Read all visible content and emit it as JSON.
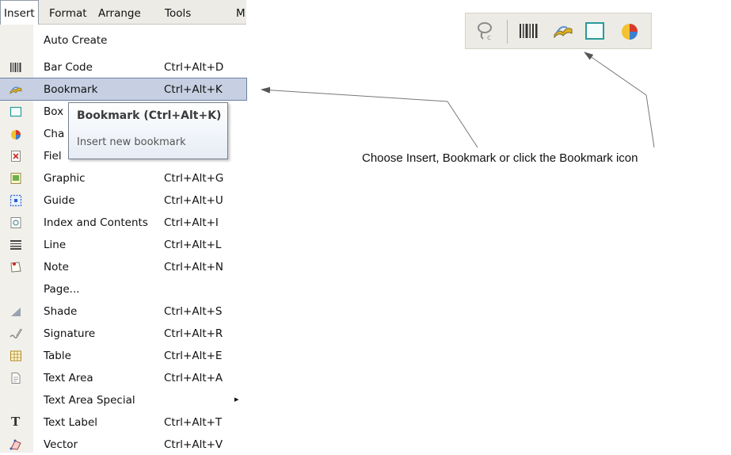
{
  "menubar": {
    "items": [
      "Insert",
      "Format",
      "Arrange",
      "Tools",
      "M"
    ]
  },
  "menu": {
    "items": [
      {
        "label": "Auto Create",
        "shortcut": "",
        "icon": "none"
      },
      {
        "label": "Bar Code",
        "shortcut": "Ctrl+Alt+D",
        "icon": "barcode-icon"
      },
      {
        "label": "Bookmark",
        "shortcut": "Ctrl+Alt+K",
        "icon": "bookmark-icon",
        "highlighted": true
      },
      {
        "label": "Box",
        "shortcut": "",
        "icon": "box-icon"
      },
      {
        "label": "Cha",
        "shortcut": "",
        "icon": "chart-icon"
      },
      {
        "label": "Fiel",
        "shortcut": "",
        "icon": "field-icon"
      },
      {
        "label": "Graphic",
        "shortcut": "Ctrl+Alt+G",
        "icon": "graphic-icon"
      },
      {
        "label": "Guide",
        "shortcut": "Ctrl+Alt+U",
        "icon": "guide-icon"
      },
      {
        "label": "Index and Contents",
        "shortcut": "Ctrl+Alt+I",
        "icon": "index-icon"
      },
      {
        "label": "Line",
        "shortcut": "Ctrl+Alt+L",
        "icon": "line-icon"
      },
      {
        "label": "Note",
        "shortcut": "Ctrl+Alt+N",
        "icon": "note-icon"
      },
      {
        "label": "Page...",
        "shortcut": "",
        "icon": "none"
      },
      {
        "label": "Shade",
        "shortcut": "Ctrl+Alt+S",
        "icon": "shade-icon"
      },
      {
        "label": "Signature",
        "shortcut": "Ctrl+Alt+R",
        "icon": "signature-icon"
      },
      {
        "label": "Table",
        "shortcut": "Ctrl+Alt+E",
        "icon": "table-icon"
      },
      {
        "label": "Text Area",
        "shortcut": "Ctrl+Alt+A",
        "icon": "text-area-icon"
      },
      {
        "label": "Text Area Special",
        "shortcut": "",
        "icon": "none",
        "submenu": true
      },
      {
        "label": "Text Label",
        "shortcut": "Ctrl+Alt+T",
        "icon": "text-label-icon"
      },
      {
        "label": "Vector",
        "shortcut": "Ctrl+Alt+V",
        "icon": "vector-icon"
      }
    ]
  },
  "tooltip": {
    "title": "Bookmark (Ctrl+Alt+K)",
    "description": "Insert new bookmark"
  },
  "toolbar": {
    "icons": [
      "lasso-icon",
      "barcode-icon",
      "bookmark-icon",
      "box-icon",
      "chart-icon"
    ]
  },
  "callout": {
    "text": "Choose Insert, Bookmark or click the Bookmark icon"
  },
  "colors": {
    "highlight": "#c6d0e2",
    "highlight_border": "#6c7fa5",
    "chrome": "#ecebe5",
    "gutter": "#f1f0eb"
  }
}
